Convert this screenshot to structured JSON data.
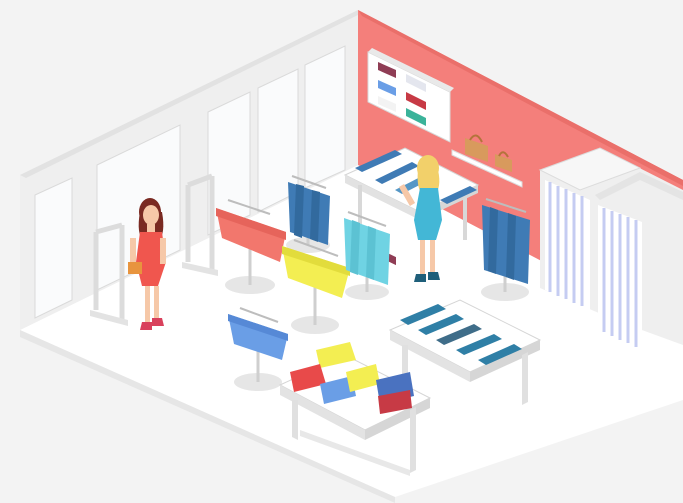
{
  "scene": {
    "subject": "isometric-clothing-store-interior",
    "colors": {
      "background": "#f3f3f3",
      "floor": "#ffffff",
      "wall": "#ececec",
      "accent_wall": "#f47f7b",
      "window": "#f9fbfc",
      "salmon_shirts": "#f2776d",
      "yellow_shirts": "#f3ee52",
      "blue_shirts": "#6a9ee6",
      "cyan_shirts": "#6fd3e3",
      "denim": "#3f7bb5",
      "teal_fold": "#2f7fa6",
      "curtain_stripe": "#c5ccf2",
      "customer_dress_red": "#f0564e",
      "customer_dress_blue": "#43b7d6"
    },
    "icons": [
      "mannequin-less-fitting-room",
      "shopping-bag",
      "hanger-rack",
      "display-table",
      "security-gate",
      "shelf-cabinet"
    ]
  }
}
